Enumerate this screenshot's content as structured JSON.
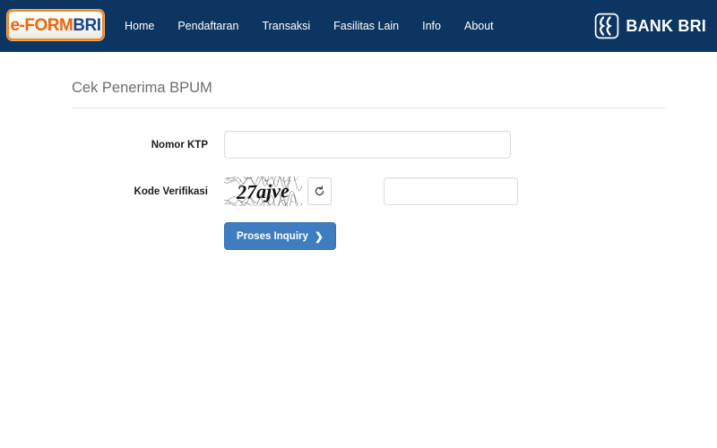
{
  "header": {
    "logo": {
      "name": "e-FORM BRI",
      "part_eform": "e-FORM",
      "part_bri": "BRI"
    },
    "nav": [
      {
        "label": "Home"
      },
      {
        "label": "Pendaftaran"
      },
      {
        "label": "Transaksi"
      },
      {
        "label": "Fasilitas Lain"
      },
      {
        "label": "Info"
      },
      {
        "label": "About"
      }
    ],
    "bank_logo": {
      "icon": "bank-bri-mark-icon",
      "text": "BANK BRI"
    },
    "background_color": "#0d3562"
  },
  "main": {
    "title": "Cek Penerima BPUM",
    "form": {
      "ktp": {
        "label": "Nomor KTP",
        "value": "",
        "placeholder": ""
      },
      "captcha": {
        "label": "Kode Verifikasi",
        "image_text": "27ajve",
        "refresh_icon": "refresh-icon",
        "input_value": "",
        "input_placeholder": ""
      },
      "submit": {
        "label": "Proses Inquiry",
        "chevron": "❯",
        "color": "#3f7cc0"
      }
    }
  }
}
